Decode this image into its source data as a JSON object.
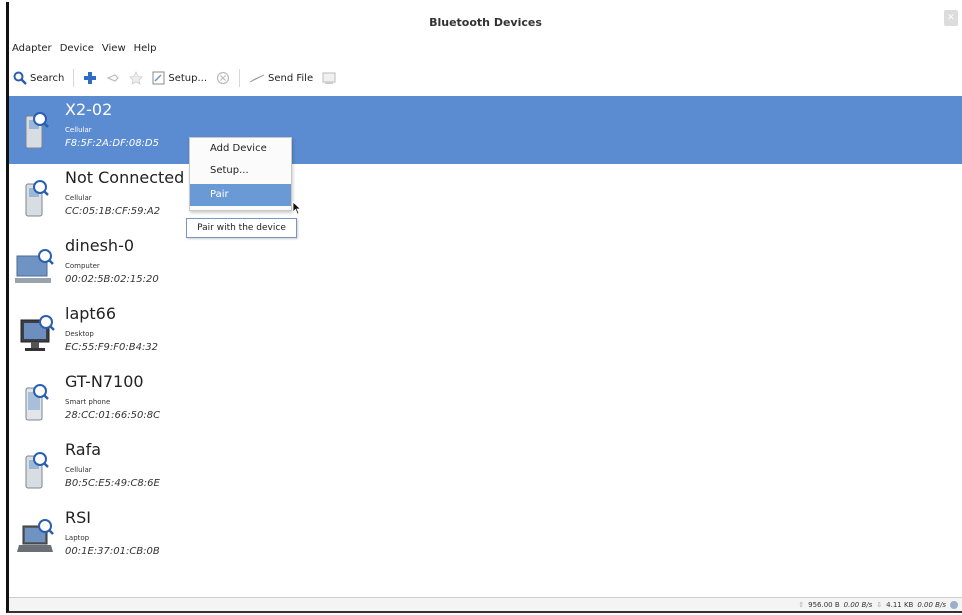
{
  "window": {
    "title": "Bluetooth Devices"
  },
  "menu": [
    "Adapter",
    "Device",
    "View",
    "Help"
  ],
  "toolbar": {
    "search_label": "Search",
    "setup_label": "Setup...",
    "send_file_label": "Send File"
  },
  "devices": [
    {
      "name": "X2-02",
      "type": "Cellular",
      "address": "F8:5F:2A:DF:08:D5",
      "icon": "cellular-icon",
      "selected": true
    },
    {
      "name": "Not Connected",
      "type": "Cellular",
      "address": "CC:05:1B:CF:59:A2",
      "icon": "cellular-icon"
    },
    {
      "name": "dinesh-0",
      "type": "Computer",
      "address": "00:02:5B:02:15:20",
      "icon": "computer-icon"
    },
    {
      "name": "lapt66",
      "type": "Desktop",
      "address": "EC:55:F9:F0:B4:32",
      "icon": "desktop-icon"
    },
    {
      "name": "GT-N7100",
      "type": "Smart phone",
      "address": "28:CC:01:66:50:8C",
      "icon": "smartphone-icon"
    },
    {
      "name": "Rafa",
      "type": "Cellular",
      "address": "B0:5C:E5:49:C8:6E",
      "icon": "cellular-icon"
    },
    {
      "name": "RSI",
      "type": "Laptop",
      "address": "00:1E:37:01:CB:0B",
      "icon": "laptop-icon"
    }
  ],
  "context_menu": {
    "items": [
      "Add Device",
      "Setup...",
      "Pair"
    ],
    "highlighted": "Pair"
  },
  "tooltip": "Pair with the device",
  "status": {
    "upload_total": "956.00 B",
    "upload_rate": "0.00 B/s",
    "download_total": "4.11 KB",
    "download_rate": "0.00 B/s"
  },
  "colors": {
    "selection": "#5b8bd0",
    "menu_highlight": "#6a9ad6"
  }
}
